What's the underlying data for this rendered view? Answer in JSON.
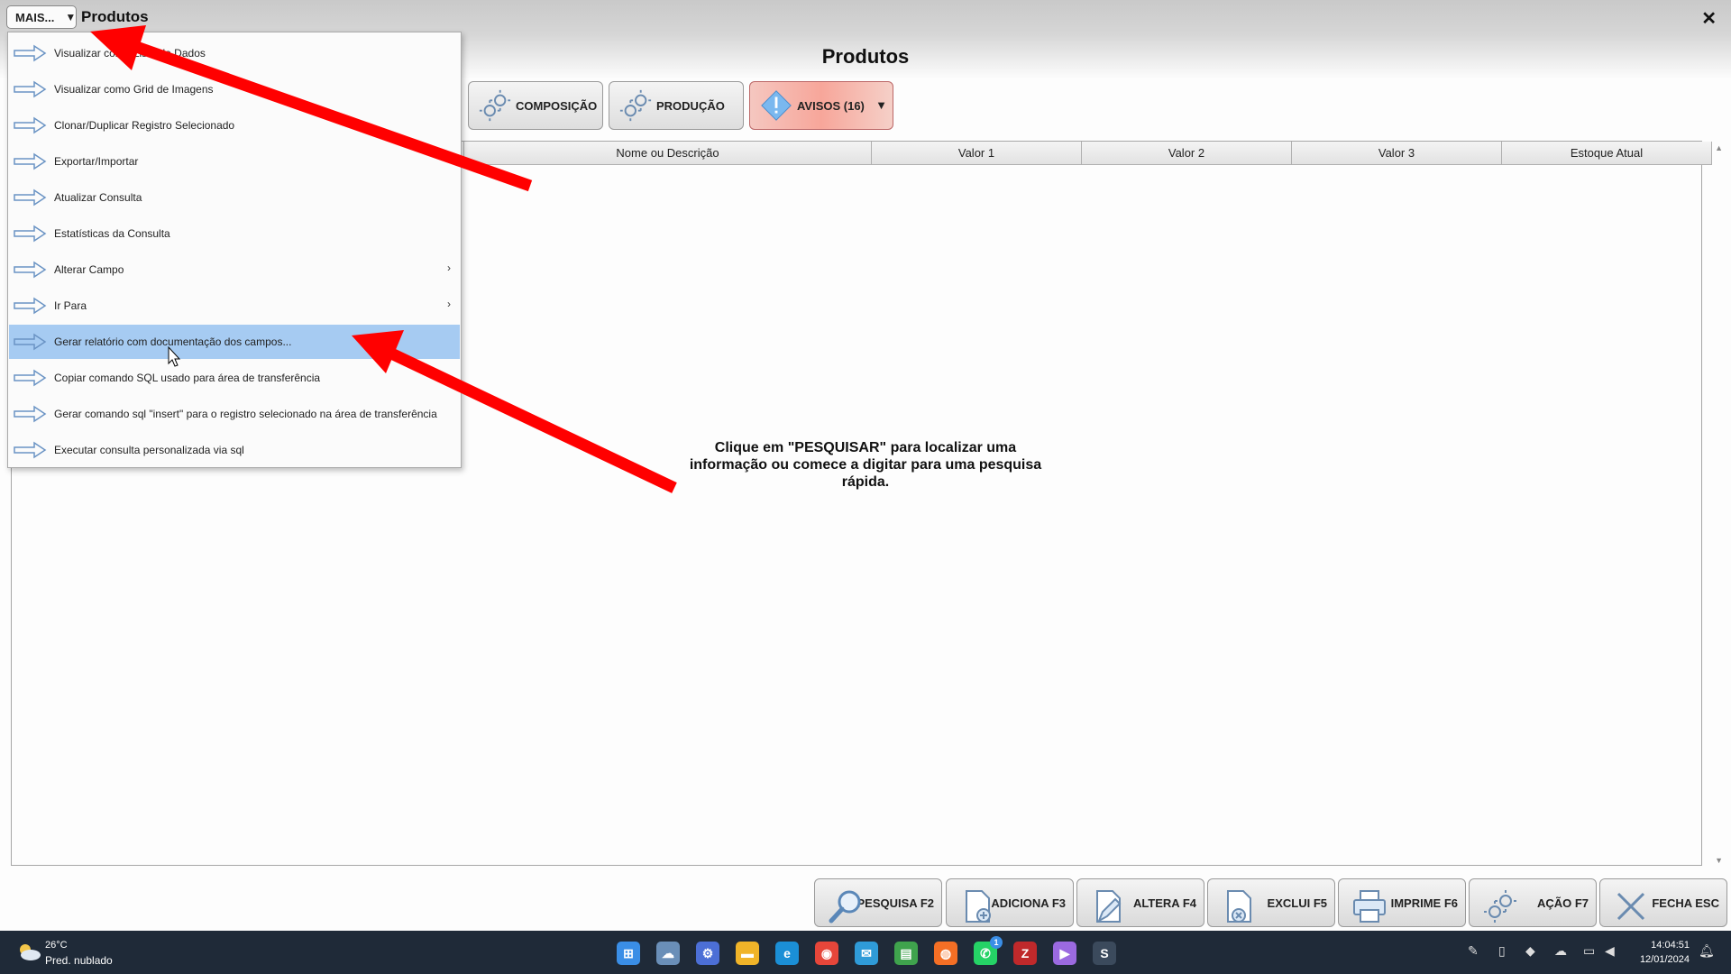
{
  "titlebar": {
    "mais_label": "MAIS...",
    "mais_arrow": "▼",
    "title": "Produtos",
    "close": "✕"
  },
  "page_title": "Produtos",
  "top_buttons": [
    {
      "label": "COMPOSIÇÃO",
      "icon": "gear-icon"
    },
    {
      "label": "PRODUÇÃO",
      "icon": "gear-icon"
    },
    {
      "label": "AVISOS (16)",
      "icon": "warning-icon",
      "dropdown": "▼"
    }
  ],
  "grid": {
    "columns": [
      "Nome ou Descrição",
      "Valor 1",
      "Valor 2",
      "Valor 3",
      "Estoque Atual"
    ],
    "scroll_up": "▲",
    "scroll_down": "▼",
    "hint": "Clique em \"PESQUISAR\" para localizar uma informação ou comece a digitar para uma pesquisa rápida."
  },
  "menu": {
    "items": [
      {
        "label": "Visualizar como Lista de Dados",
        "submenu": false
      },
      {
        "label": "Visualizar como Grid de Imagens",
        "submenu": false
      },
      {
        "label": "Clonar/Duplicar Registro Selecionado",
        "submenu": false
      },
      {
        "label": "Exportar/Importar",
        "submenu": false
      },
      {
        "label": "Atualizar Consulta",
        "submenu": false
      },
      {
        "label": "Estatísticas da Consulta",
        "submenu": false
      },
      {
        "label": "Alterar Campo",
        "submenu": true
      },
      {
        "label": "Ir Para",
        "submenu": true
      },
      {
        "label": "Gerar relatório com documentação dos campos...",
        "submenu": false,
        "active": true
      },
      {
        "label": "Copiar comando SQL usado para área de transferência",
        "submenu": false
      },
      {
        "label": "Gerar comando sql \"insert\" para o registro selecionado na área de transferência",
        "submenu": false
      },
      {
        "label": "Executar consulta personalizada via sql",
        "submenu": false
      }
    ],
    "submenu_glyph": "›"
  },
  "bottom_buttons": [
    {
      "label": "PESQUISA F2",
      "icon": "magnifier-icon"
    },
    {
      "label": "ADICIONA F3",
      "icon": "add-document-icon"
    },
    {
      "label": "ALTERA F4",
      "icon": "edit-document-icon"
    },
    {
      "label": "EXCLUI F5",
      "icon": "delete-document-icon"
    },
    {
      "label": "IMPRIME F6",
      "icon": "printer-icon"
    },
    {
      "label": "AÇÃO F7",
      "icon": "gear-icon"
    },
    {
      "label": "FECHA ESC",
      "icon": "close-icon"
    }
  ],
  "taskbar": {
    "weather_temp": "26°C",
    "weather_desc": "Pred. nublado",
    "time": "14:04:51",
    "date": "12/01/2024",
    "apps": [
      "windows-start-icon",
      "file-explorer-cloud-icon",
      "settings-icon",
      "folder-icon",
      "edge-icon",
      "chrome-icon",
      "mail-icon",
      "notepad-icon",
      "firefox-icon",
      "whatsapp-icon",
      "filezilla-icon",
      "media-player-icon",
      "app-s-icon"
    ],
    "whatsapp_badge": "1"
  },
  "colors": {
    "menu_highlight": "#a6cbf2",
    "annotation_red": "#ff0000",
    "taskbar": "#1f2a38"
  }
}
